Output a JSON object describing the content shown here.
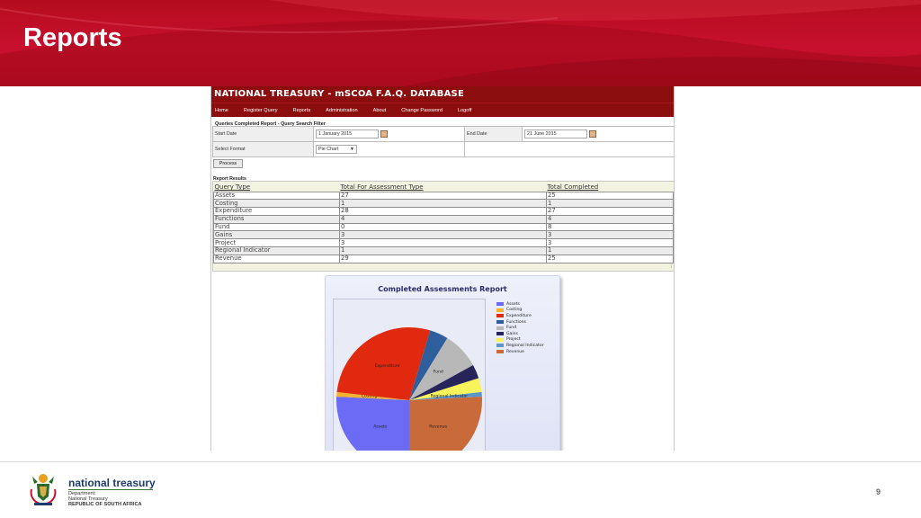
{
  "slide": {
    "title": "Reports",
    "page_number": "9"
  },
  "app": {
    "title": "NATIONAL TREASURY - mSCOA F.A.Q. DATABASE",
    "nav": [
      "Home",
      "Register Query",
      "Reports",
      "Administration",
      "About",
      "Change Password",
      "Logoff"
    ]
  },
  "filter": {
    "section_title": "Queries Completed Report - Query Search Filter",
    "start_label": "Start Date",
    "start_value": "1 January 2015",
    "end_label": "End Date",
    "end_value": "21 June 2015",
    "format_label": "Select Format",
    "format_value": "Pie Chart",
    "process_label": "Process"
  },
  "results": {
    "section_title": "Report Results",
    "headers": [
      "Query Type",
      "Total For Assessment Type",
      "Total Completed"
    ],
    "rows": [
      [
        "Assets",
        "27",
        "25"
      ],
      [
        "Costing",
        "1",
        "1"
      ],
      [
        "Expenditure",
        "28",
        "27"
      ],
      [
        "Functions",
        "4",
        "4"
      ],
      [
        "Fund",
        "0",
        "8"
      ],
      [
        "Gains",
        "3",
        "3"
      ],
      [
        "Project",
        "3",
        "3"
      ],
      [
        "Regional Indicator",
        "1",
        "1"
      ],
      [
        "Revenue",
        "29",
        "25"
      ]
    ]
  },
  "chart_data": {
    "type": "pie",
    "title": "Completed Assessments Report",
    "categories": [
      "Assets",
      "Costing",
      "Expenditure",
      "Functions",
      "Fund",
      "Gains",
      "Project",
      "Regional Indicator",
      "Revenue"
    ],
    "values": [
      25,
      1,
      27,
      4,
      8,
      3,
      3,
      1,
      25
    ],
    "colors": [
      "#6b6bf5",
      "#f2b32e",
      "#e0290f",
      "#2e5e9c",
      "#b8b8b8",
      "#27245a",
      "#f6f45a",
      "#5d97c9",
      "#c86a39"
    ],
    "slice_labels": [
      "Assets",
      "Costing",
      "Expenditure",
      "",
      "Fund",
      "",
      "",
      "Regional Indicator",
      "Revenue"
    ],
    "legend_position": "right"
  },
  "footer": {
    "brand": "national treasury",
    "dept_line1": "Department:",
    "dept_line2": "National Treasury",
    "country": "REPUBLIC OF SOUTH AFRICA"
  }
}
